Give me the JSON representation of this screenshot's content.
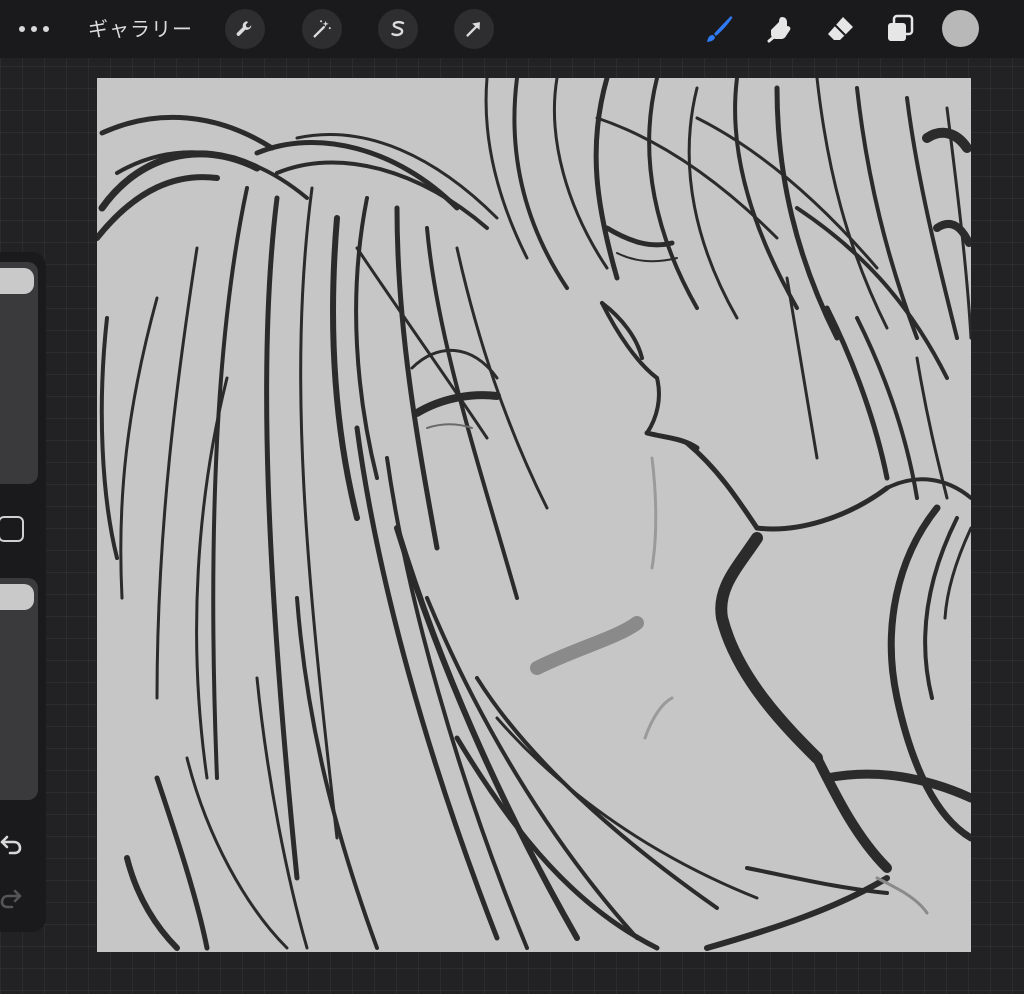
{
  "toolbar": {
    "more_icon": "ellipsis-icon",
    "gallery_label": "ギャラリー",
    "actions_icon": "wrench-icon",
    "adjustments_icon": "magic-wand-icon",
    "selection_icon": "selection-s-icon",
    "transform_icon": "arrow-icon",
    "brush_icon": "brush-icon",
    "smudge_icon": "smudge-finger-icon",
    "eraser_icon": "eraser-icon",
    "layers_icon": "layers-icon",
    "active_tool": "brush",
    "active_color": "#b8b8b8",
    "accent_color": "#2f7bf5"
  },
  "sidebar": {
    "brush_size_icon": "brush-size-slider",
    "brush_size_level": 0.05,
    "modify_icon": "square-modify-icon",
    "opacity_icon": "opacity-slider",
    "opacity_level": 0.05,
    "undo_icon": "undo-icon",
    "redo_icon": "redo-icon",
    "redo_enabled": false
  },
  "canvas": {
    "background_color": "#c6c6c6",
    "stroke_color": "#2a2a2a",
    "artwork": "sketch-drawing"
  }
}
